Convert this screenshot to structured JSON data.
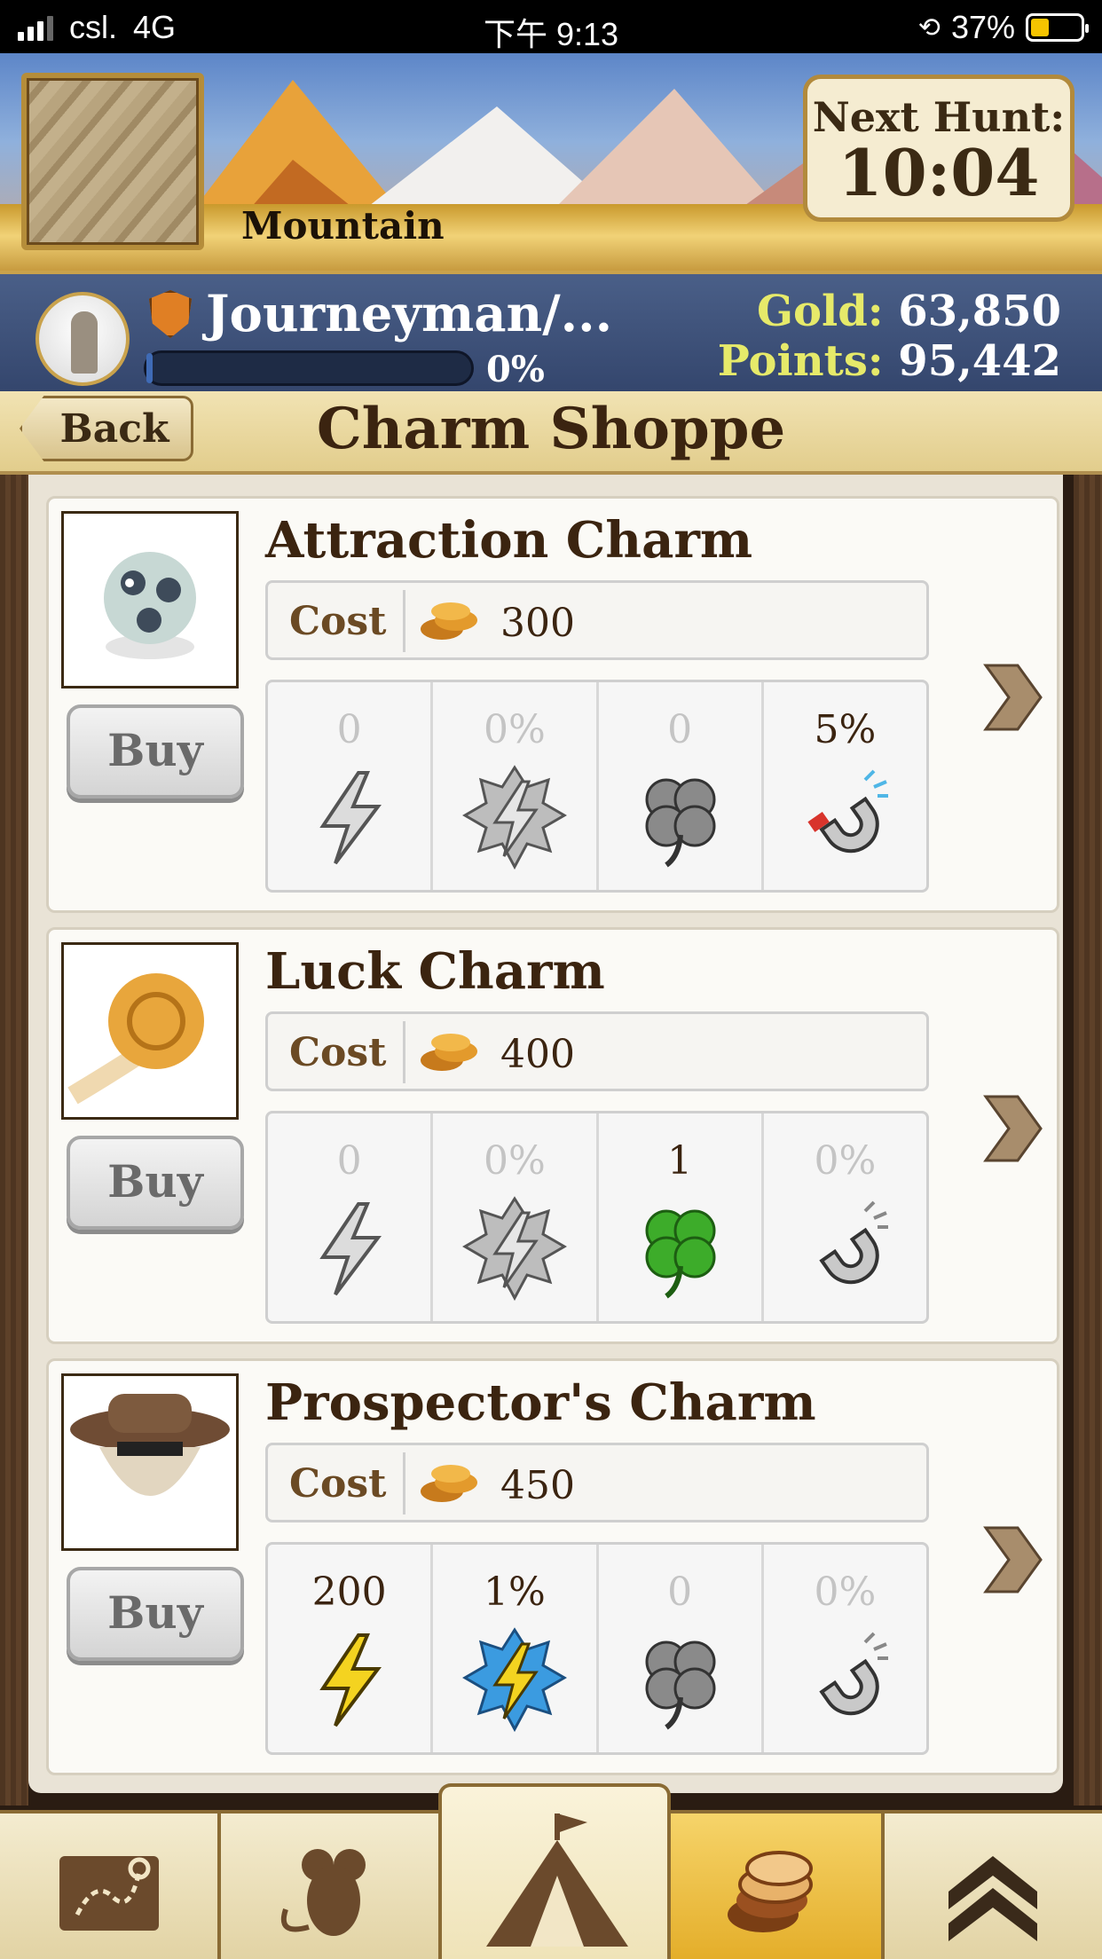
{
  "status_bar": {
    "carrier": "csl.",
    "network": "4G",
    "time": "下午 9:13",
    "battery": "37%"
  },
  "location": {
    "name": "Mountain"
  },
  "next_hunt": {
    "label": "Next Hunt:",
    "value": "10:04"
  },
  "player": {
    "rank": "Journeyman/...",
    "progress_text": "0%",
    "progress_fraction": 0.02,
    "gold_label": "Gold:",
    "gold": "63,850",
    "points_label": "Points:",
    "points": "95,442"
  },
  "nav": {
    "back": "Back",
    "title": "Charm Shoppe"
  },
  "charms": [
    {
      "name": "Attraction Charm",
      "cost_label": "Cost",
      "cost": "300",
      "buy": "Buy",
      "stats": [
        {
          "value": "0",
          "icon": "power-icon",
          "active": false
        },
        {
          "value": "0%",
          "icon": "power-bonus-icon",
          "active": false
        },
        {
          "value": "0",
          "icon": "luck-clover-icon",
          "active": false
        },
        {
          "value": "5%",
          "icon": "attraction-magnet-icon",
          "active": true
        }
      ]
    },
    {
      "name": "Luck Charm",
      "cost_label": "Cost",
      "cost": "400",
      "buy": "Buy",
      "stats": [
        {
          "value": "0",
          "icon": "power-icon",
          "active": false
        },
        {
          "value": "0%",
          "icon": "power-bonus-icon",
          "active": false
        },
        {
          "value": "1",
          "icon": "luck-clover-icon",
          "active": true
        },
        {
          "value": "0%",
          "icon": "attraction-magnet-icon",
          "active": false
        }
      ]
    },
    {
      "name": "Prospector's Charm",
      "cost_label": "Cost",
      "cost": "450",
      "buy": "Buy",
      "stats": [
        {
          "value": "200",
          "icon": "power-icon",
          "active": true
        },
        {
          "value": "1%",
          "icon": "power-bonus-icon",
          "active": true
        },
        {
          "value": "0",
          "icon": "luck-clover-icon",
          "active": false
        },
        {
          "value": "0%",
          "icon": "attraction-magnet-icon",
          "active": false
        }
      ]
    }
  ],
  "bottom_nav": [
    "treasure-map-icon",
    "mouse-icon",
    "camp-tent-icon",
    "gold-coins-icon",
    "more-chevrons-icon"
  ],
  "colors": {
    "accent_gold": "#e4ae2a",
    "title_brown": "#3b2410",
    "player_bar": "#3f527a"
  }
}
